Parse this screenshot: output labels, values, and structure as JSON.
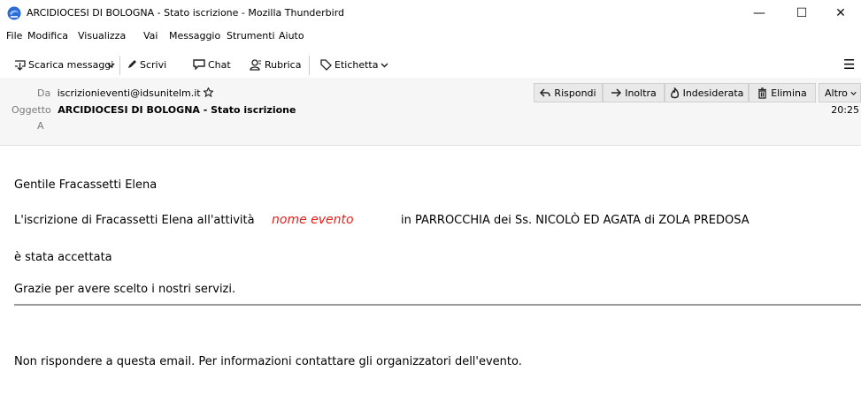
{
  "window": {
    "title": "ARCIDIOCESI DI BOLOGNA - Stato iscrizione - Mozilla Thunderbird",
    "minimize": "—",
    "maximize": "☐",
    "close": "✕"
  },
  "menu": [
    "File",
    "Modifica",
    "Visualizza",
    "Vai",
    "Messaggio",
    "Strumenti",
    "Aiuto"
  ],
  "toolbar": {
    "get_messages": "Scarica messaggi",
    "write": "Scrivi",
    "chat": "Chat",
    "address_book": "Rubrica",
    "tag": "Etichetta",
    "hamburger": "☰"
  },
  "header": {
    "from_label": "Da",
    "from_value": "iscrizionieventi@idsunitelm.it",
    "subject_label": "Oggetto",
    "subject_value": "ARCIDIOCESI DI BOLOGNA - Stato iscrizione",
    "to_label": "A",
    "time": "20:25",
    "buttons": {
      "reply": "Rispondi",
      "forward": "Inoltra",
      "junk": "Indesiderata",
      "delete": "Elimina",
      "more": "Altro"
    }
  },
  "message": {
    "greeting": "Gentile Fracassetti Elena",
    "line1_pre": "L'iscrizione di Fracassetti Elena all'attività",
    "event_name": "nome evento",
    "line1_post": "in PARROCCHIA dei Ss. NICOLÒ ED AGATA di ZOLA PREDOSA",
    "accepted": "è stata accettata",
    "thanks": "Grazie per avere scelto i nostri servizi.",
    "footer": "Non rispondere a questa email. Per informazioni contattare gli organizzatori dell'evento."
  },
  "colors": {
    "event_name": "#e8201a",
    "header_bg": "#f6f6f6",
    "label_gray": "#7a7a7a"
  }
}
